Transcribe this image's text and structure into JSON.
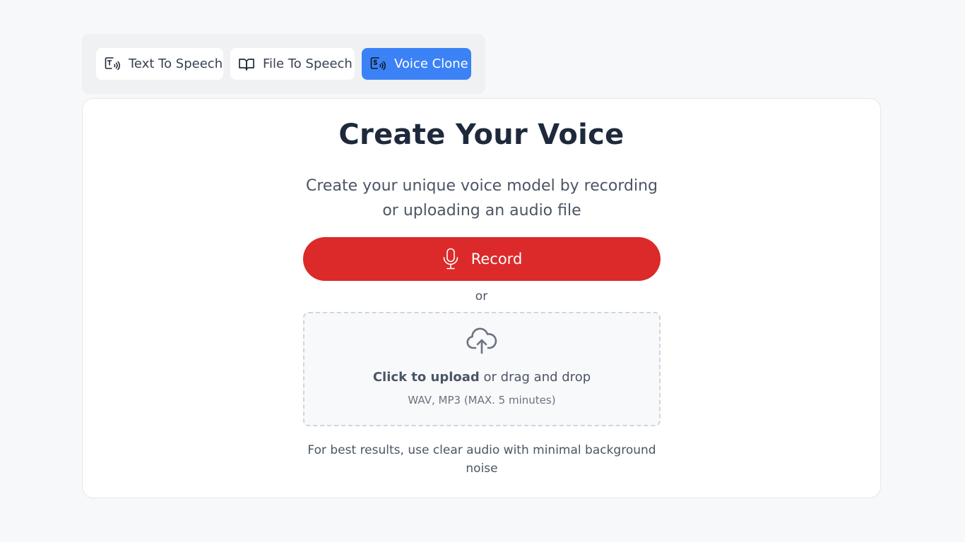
{
  "tabs": [
    {
      "label": "Text To Speech",
      "icon": "text-to-speech-icon",
      "active": false
    },
    {
      "label": "File To Speech",
      "icon": "open-book-icon",
      "active": false
    },
    {
      "label": "Voice Clone",
      "icon": "voice-clone-icon",
      "active": true
    }
  ],
  "main": {
    "title": "Create Your Voice",
    "subtitle": "Create your unique voice model by recording or uploading an audio file",
    "record_label": "Record",
    "record_icon": "microphone-icon",
    "or_text": "or",
    "upload": {
      "icon": "cloud-upload-icon",
      "click_text": "Click to upload",
      "drag_text": " or drag and drop",
      "formats": "WAV, MP3 (MAX. 5 minutes)"
    },
    "hint": "For best results, use clear audio with minimal background noise"
  },
  "colors": {
    "accent": "#3b82f6",
    "record": "#dc2a2a",
    "background": "#f7f8fa"
  }
}
